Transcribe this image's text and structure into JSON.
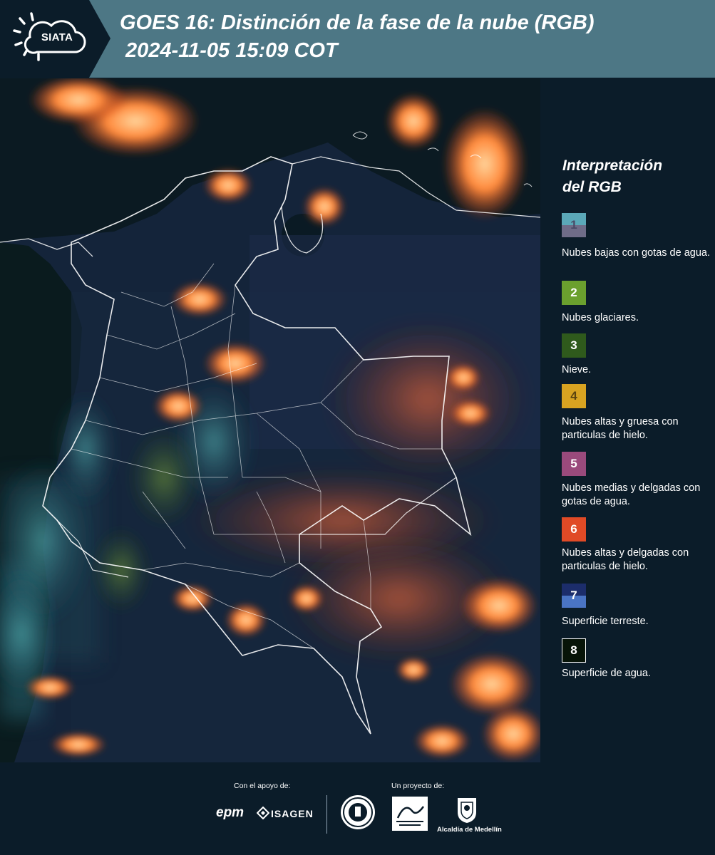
{
  "header": {
    "logo_text": "SIATA",
    "title_line1": "GOES 16: Distinción de la fase de la nube (RGB)",
    "title_line2": "2024-11-05 15:09 COT",
    "background_color": "#4d7785"
  },
  "legend": {
    "title_line1": "Interpretación",
    "title_line2": "del RGB",
    "items": [
      {
        "number": "1",
        "label": "Nubes bajas con gotas de agua.",
        "colors": [
          "#5ba8b8",
          "#6f6c88"
        ]
      },
      {
        "number": "2",
        "label": "Nubes glaciares.",
        "colors": [
          "#6ba02e"
        ]
      },
      {
        "number": "3",
        "label": "Nieve.",
        "colors": [
          "#2f5a1c"
        ]
      },
      {
        "number": "4",
        "label": "Nubes altas y gruesa con particulas de hielo.",
        "colors": [
          "#d8a321"
        ]
      },
      {
        "number": "5",
        "label": "Nubes medias y delgadas con gotas de agua.",
        "colors": [
          "#9a4a7c"
        ]
      },
      {
        "number": "6",
        "label": "Nubes altas y delgadas con particulas de hielo.",
        "colors": [
          "#e04a26"
        ]
      },
      {
        "number": "7",
        "label": "Superficie terreste.",
        "colors": [
          "#1c2d6b",
          "#4a74c4"
        ]
      },
      {
        "number": "8",
        "label": "Superficie de agua.",
        "colors": [
          "#071408"
        ]
      }
    ]
  },
  "footer": {
    "support_label": "Con el apoyo de:",
    "project_label": "Un proyecto de:",
    "sponsor_1": "epm",
    "sponsor_2": "ISAGEN",
    "partner_label": "Alcaldía de Medellín"
  }
}
